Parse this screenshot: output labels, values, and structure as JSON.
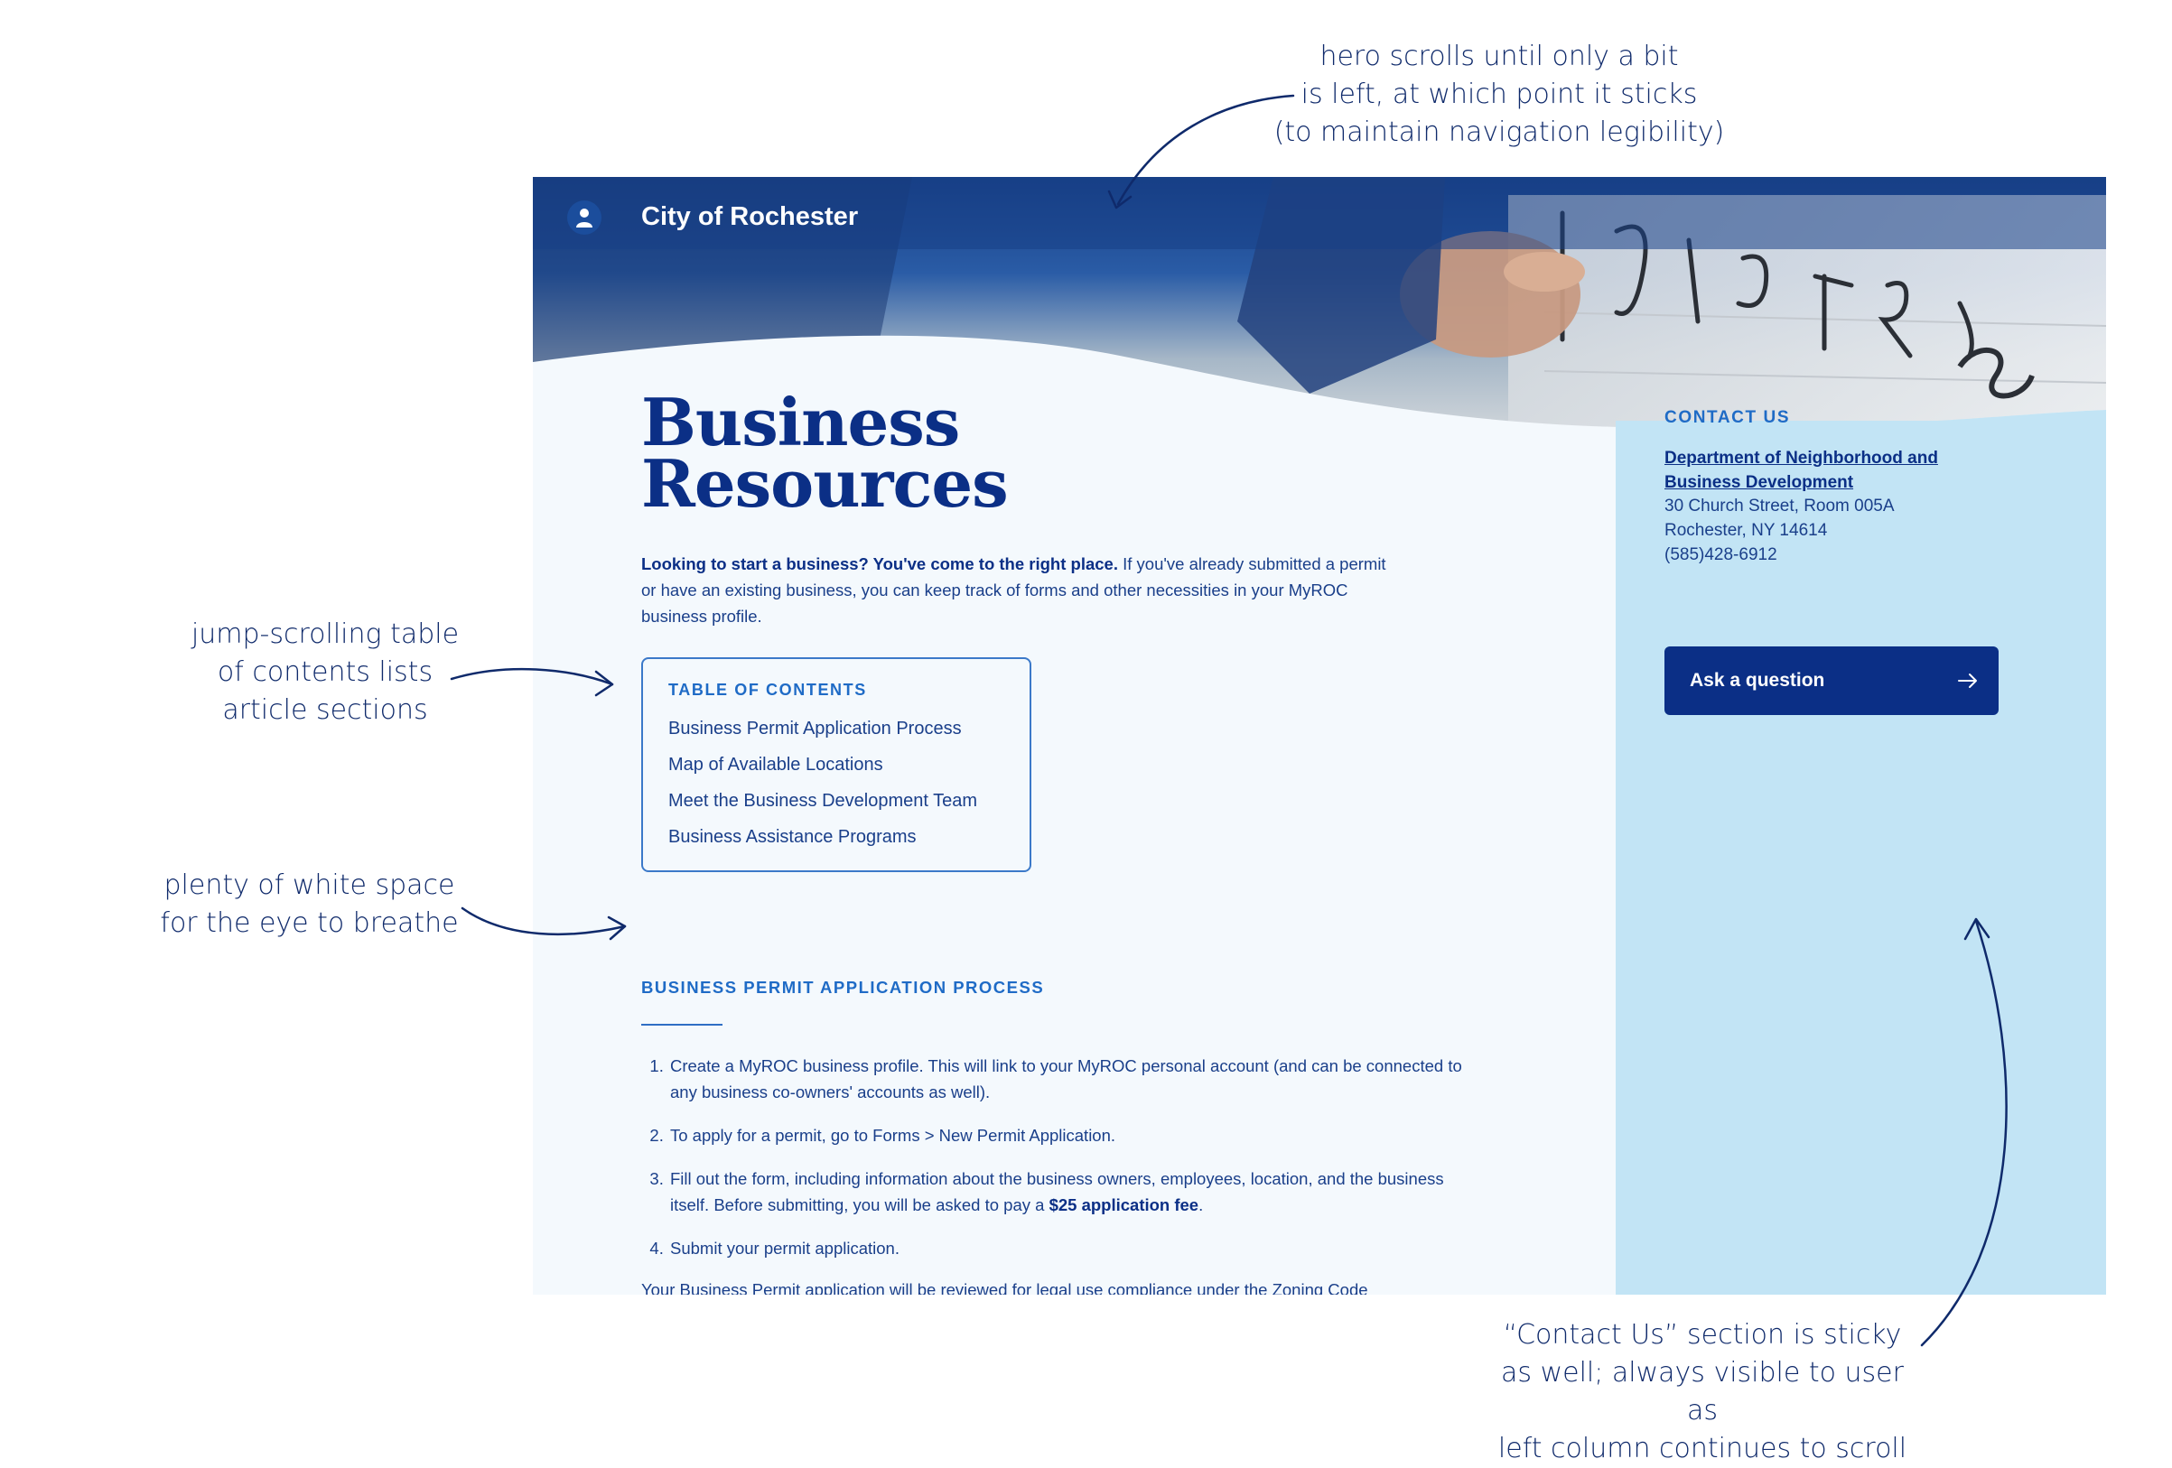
{
  "annotations": {
    "hero": [
      "hero scrolls until only a bit",
      "is left, at which point it sticks",
      "(to maintain navigation legibility)"
    ],
    "toc": [
      "jump-scrolling table",
      "of contents lists",
      "article sections"
    ],
    "white_space": [
      "plenty of white space",
      "for the eye to breathe"
    ],
    "contact": [
      "“Contact Us” section is sticky",
      "as well; always visible to user as",
      "left column continues to scroll"
    ]
  },
  "header": {
    "site_title": "City of Rochester",
    "logo_icon": "person-icon"
  },
  "main": {
    "title_line1": "Business",
    "title_line2": "Resources",
    "intro_bold": "Looking to start a business? You've come to the right place.",
    "intro_rest": " If you've already submitted a permit or have an existing business, you can keep track of forms and other necessities in your MyROC business profile.",
    "toc": {
      "heading": "TABLE OF CONTENTS",
      "items": [
        "Business Permit Application Process",
        "Map of Available Locations",
        "Meet the Business Development Team",
        "Business Assistance Programs"
      ]
    },
    "section_heading": "BUSINESS PERMIT APPLICATION PROCESS",
    "steps": {
      "s1": "Create a MyROC business profile. This will link to your MyROC personal account (and can be connected to any business co-owners' accounts as well).",
      "s2": "To apply for a permit, go to Forms > New Permit Application.",
      "s3_before": "Fill out the form, including information about the business owners, employees, location, and the business itself. Before submitting, you will be asked to pay a ",
      "s3_bold": "$25 application fee",
      "s3_after": ".",
      "s4": "Submit your permit application."
    },
    "cutoff_text": "Your Business Permit application will be reviewed for legal use compliance under the Zoning Code"
  },
  "sidebar": {
    "contact_heading": "CONTACT US",
    "department": "Department of Neighborhood and Business Development",
    "address_line1": "30 Church Street, Room 005A",
    "address_line2": "Rochester, NY 14614",
    "phone": "(585)428-6912",
    "ask_button": "Ask a question",
    "ask_icon": "arrow-right-icon"
  },
  "colors": {
    "navy": "#0b2f86",
    "accent_blue": "#1f6bc6",
    "page_bg": "#f4f9fd",
    "sidebar_bg": "#c2e4f5"
  }
}
